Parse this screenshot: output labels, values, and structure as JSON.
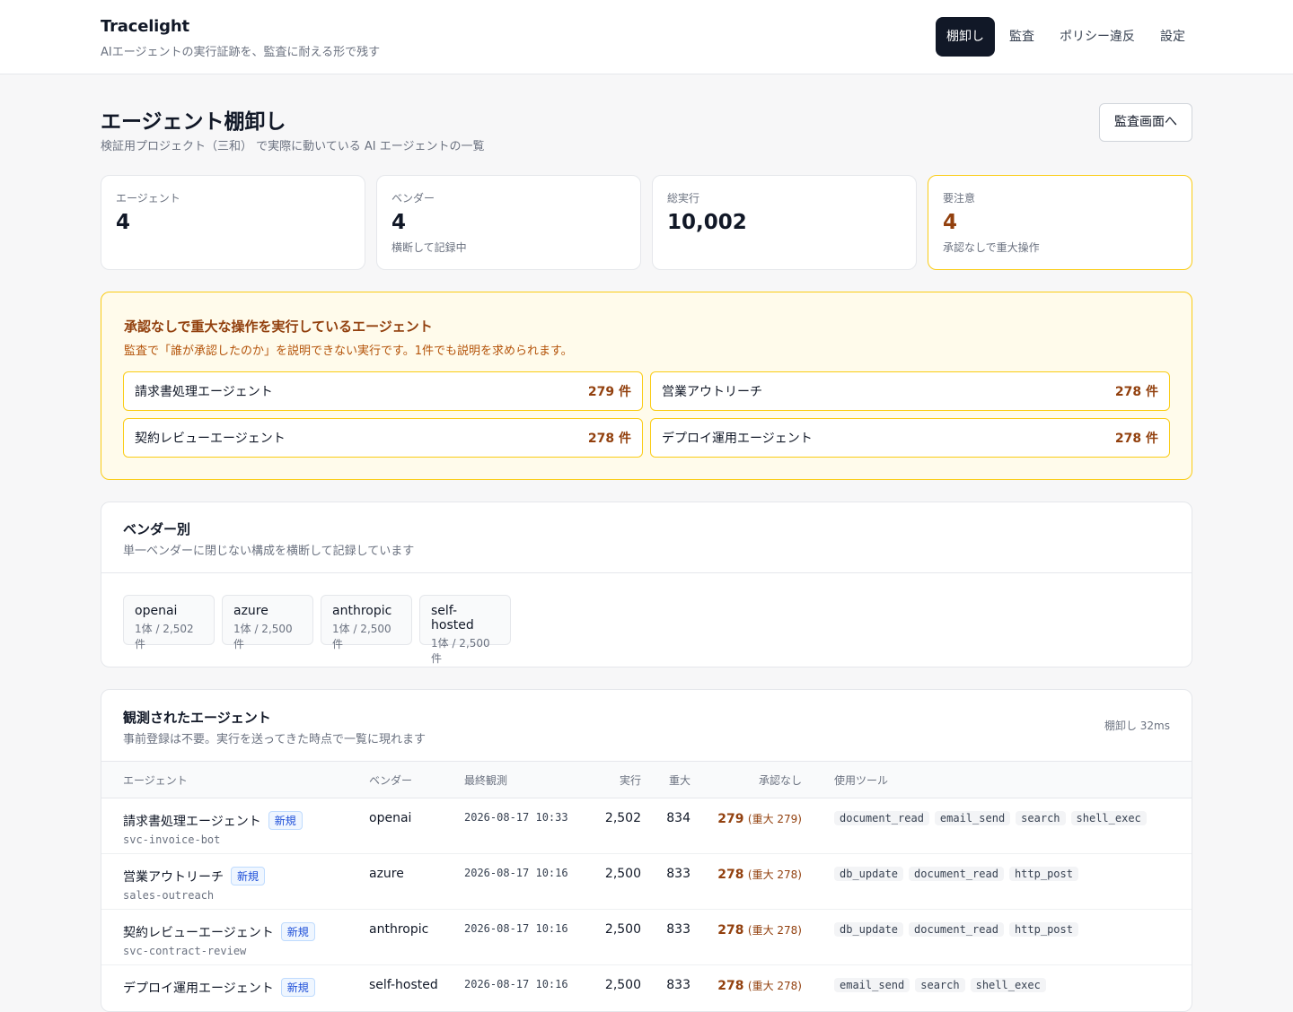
{
  "app": {
    "name": "Tracelight",
    "tagline": "AIエージェントの実行証跡を、監査に耐える形で残す"
  },
  "nav": [
    "棚卸し",
    "監査",
    "ポリシー違反",
    "設定"
  ],
  "nav_active": "棚卸し",
  "page": {
    "title": "エージェント棚卸し",
    "subtitle": "検証用プロジェクト（三和） で実際に動いている AI エージェントの一覧",
    "audit_button": "監査画面へ"
  },
  "stats": [
    {
      "label": "エージェント",
      "value": "4",
      "note": ""
    },
    {
      "label": "ベンダー",
      "value": "4",
      "note": "横断して記録中"
    },
    {
      "label": "総実行",
      "value": "10,002",
      "note": ""
    },
    {
      "label": "要注意",
      "value": "4",
      "note": "承認なしで重大操作"
    }
  ],
  "alert": {
    "title": "承認なしで重大な操作を実行しているエージェント",
    "description": "監査で「誰が承認したのか」を説明できない実行です。1件でも説明を求められます。",
    "items": [
      {
        "name": "請求書処理エージェント",
        "count": "279 件"
      },
      {
        "name": "営業アウトリーチ",
        "count": "278 件"
      },
      {
        "name": "契約レビューエージェント",
        "count": "278 件"
      },
      {
        "name": "デプロイ運用エージェント",
        "count": "278 件"
      }
    ]
  },
  "vendors": {
    "title": "ベンダー別",
    "subtitle": "単一ベンダーに閉じない構成を横断して記録しています",
    "items": [
      {
        "name": "openai",
        "count": "1体 / 2,502件"
      },
      {
        "name": "azure",
        "count": "1体 / 2,500件"
      },
      {
        "name": "anthropic",
        "count": "1体 / 2,500件"
      },
      {
        "name": "self-hosted",
        "count": "1体 / 2,500件"
      }
    ]
  },
  "agents": {
    "title": "観測されたエージェント",
    "subtitle": "事前登録は不要。実行を送ってきた時点で一覧に現れます",
    "meta": "棚卸し 32ms",
    "columns": {
      "agent": "エージェント",
      "vendor": "ベンダー",
      "last_seen": "最終観測",
      "runs": "実行",
      "critical": "重大",
      "unapproved": "承認なし",
      "tools": "使用ツール"
    },
    "rows": [
      {
        "name": "請求書処理エージェント",
        "badge": "新規",
        "id": "svc-invoice-bot",
        "vendor": "openai",
        "last_seen": "2026-08-17 10:33",
        "runs": "2,502",
        "critical": "834",
        "unapproved": "279",
        "unapproved_note": "(重大 279)",
        "tools": [
          "document_read",
          "email_send",
          "search",
          "shell_exec"
        ]
      },
      {
        "name": "営業アウトリーチ",
        "badge": "新規",
        "id": "sales-outreach",
        "vendor": "azure",
        "last_seen": "2026-08-17 10:16",
        "runs": "2,500",
        "critical": "833",
        "unapproved": "278",
        "unapproved_note": "(重大 278)",
        "tools": [
          "db_update",
          "document_read",
          "http_post"
        ]
      },
      {
        "name": "契約レビューエージェント",
        "badge": "新規",
        "id": "svc-contract-review",
        "vendor": "anthropic",
        "last_seen": "2026-08-17 10:16",
        "runs": "2,500",
        "critical": "833",
        "unapproved": "278",
        "unapproved_note": "(重大 278)",
        "tools": [
          "db_update",
          "document_read",
          "http_post"
        ]
      },
      {
        "name": "デプロイ運用エージェント",
        "badge": "新規",
        "id": "",
        "vendor": "self-hosted",
        "last_seen": "2026-08-17 10:16",
        "runs": "2,500",
        "critical": "833",
        "unapproved": "278",
        "unapproved_note": "(重大 278)",
        "tools": [
          "email_send",
          "search",
          "shell_exec"
        ]
      }
    ]
  },
  "colors": {
    "primary": "#111827",
    "warning_border": "#facc15",
    "warning_bg": "#fffbeb",
    "warning_text": "#92400e",
    "badge_blue": "#1d4ed8"
  }
}
